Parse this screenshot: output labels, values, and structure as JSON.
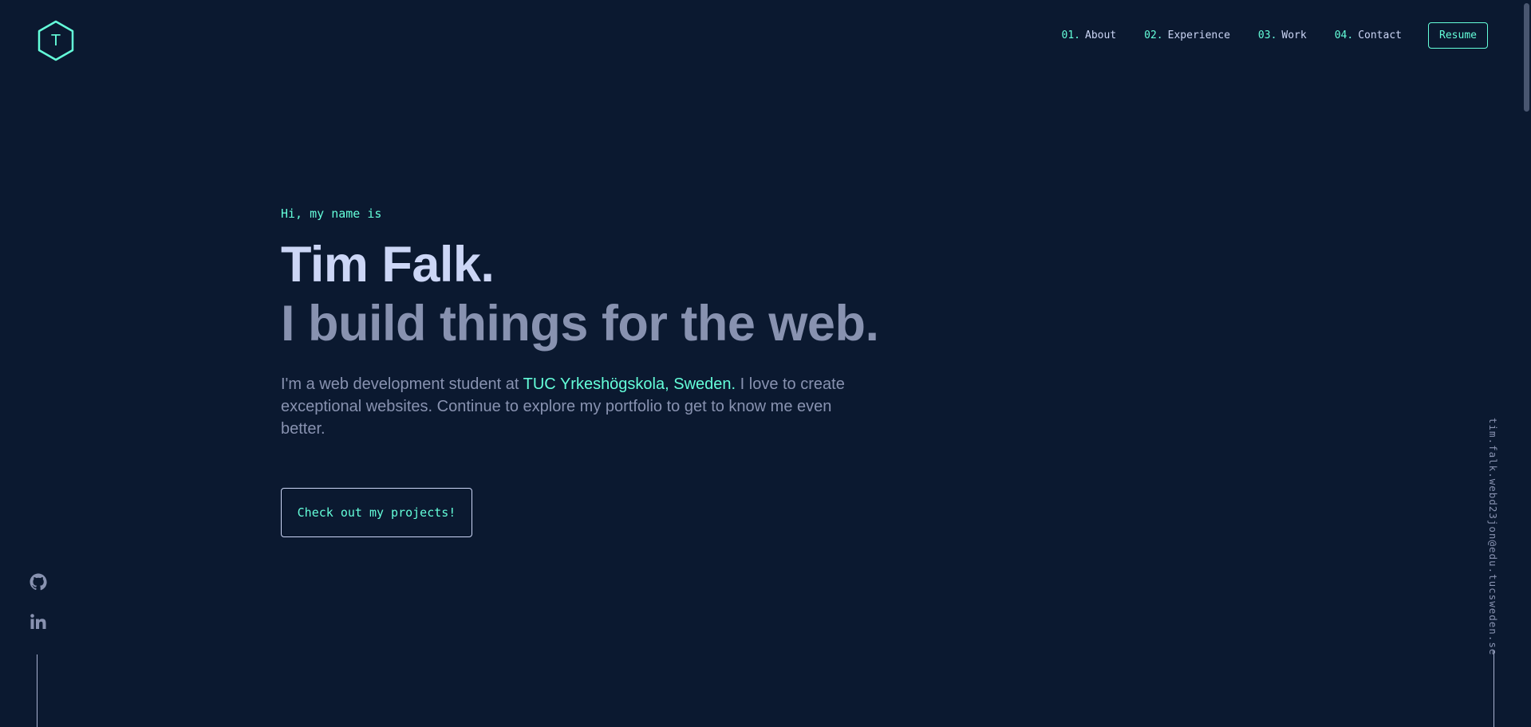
{
  "header": {
    "logo_letter": "T",
    "nav": [
      {
        "num": "01.",
        "label": "About"
      },
      {
        "num": "02.",
        "label": "Experience"
      },
      {
        "num": "03.",
        "label": "Work"
      },
      {
        "num": "04.",
        "label": "Contact"
      }
    ],
    "resume_label": "Resume"
  },
  "hero": {
    "greeting": "Hi, my name is",
    "name": "Tim Falk.",
    "tagline": "I build things for the web.",
    "intro_before": "I'm a web development student at ",
    "intro_highlight": "TUC Yrkeshögskola, Sweden.",
    "intro_after": " I love to create exceptional websites. Continue to explore my portfolio to get to know me even better.",
    "cta_label": "Check out my projects!"
  },
  "socials": [
    {
      "icon": "github-icon"
    },
    {
      "icon": "linkedin-icon"
    }
  ],
  "email": "tim.falk.webd23jon@edu.tucsweden.se",
  "colors": {
    "background": "#0b1930",
    "accent": "#64ffda",
    "heading": "#ccd6f6",
    "text": "#8892b0"
  }
}
